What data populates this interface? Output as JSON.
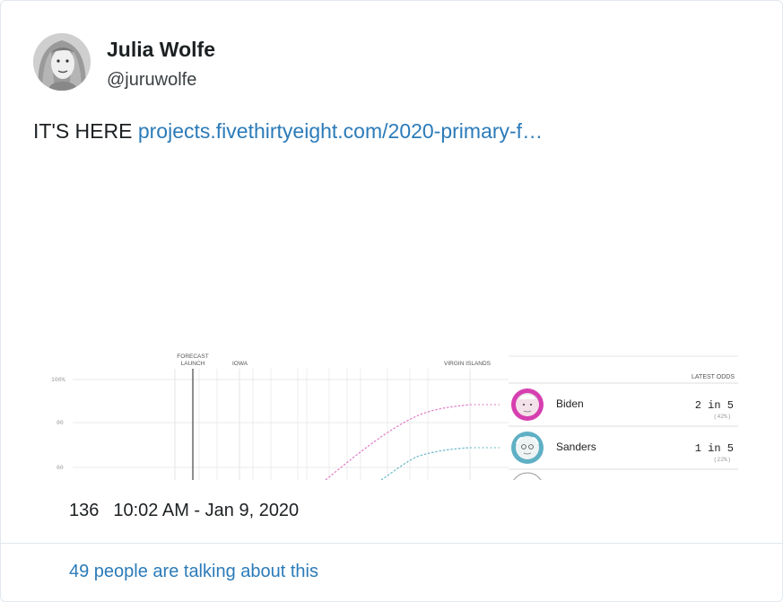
{
  "tweet": {
    "author_name": "Julia Wolfe",
    "author_handle": "@juruwolfe",
    "text": "IT'S HERE",
    "link_text": "projects.fivethirtyeight.com/2020-primary-f…",
    "like_count": "136",
    "timestamp": "10:02 AM - Jan 9, 2020",
    "talking_text": "49 people are talking about this"
  },
  "media": {
    "event_labels": [
      "FORECAST",
      "LAUNCH",
      "IOWA",
      "VIRGIN ISLANDS"
    ],
    "y_ticks": [
      "100%",
      "80",
      "60"
    ],
    "odds_header": "LATEST ODDS",
    "candidates": [
      {
        "name": "Biden",
        "odds": "2 in 5",
        "pct": "(42%)",
        "color": "#d63fb0"
      },
      {
        "name": "Sanders",
        "odds": "1 in 5",
        "pct": "(22%)",
        "color": "#5fb0c4"
      }
    ]
  },
  "colors": {
    "link": "#2b7bb9",
    "border": "#e1e8ed",
    "biden_line": "#e07ac4",
    "sanders_line": "#67b8c8"
  }
}
